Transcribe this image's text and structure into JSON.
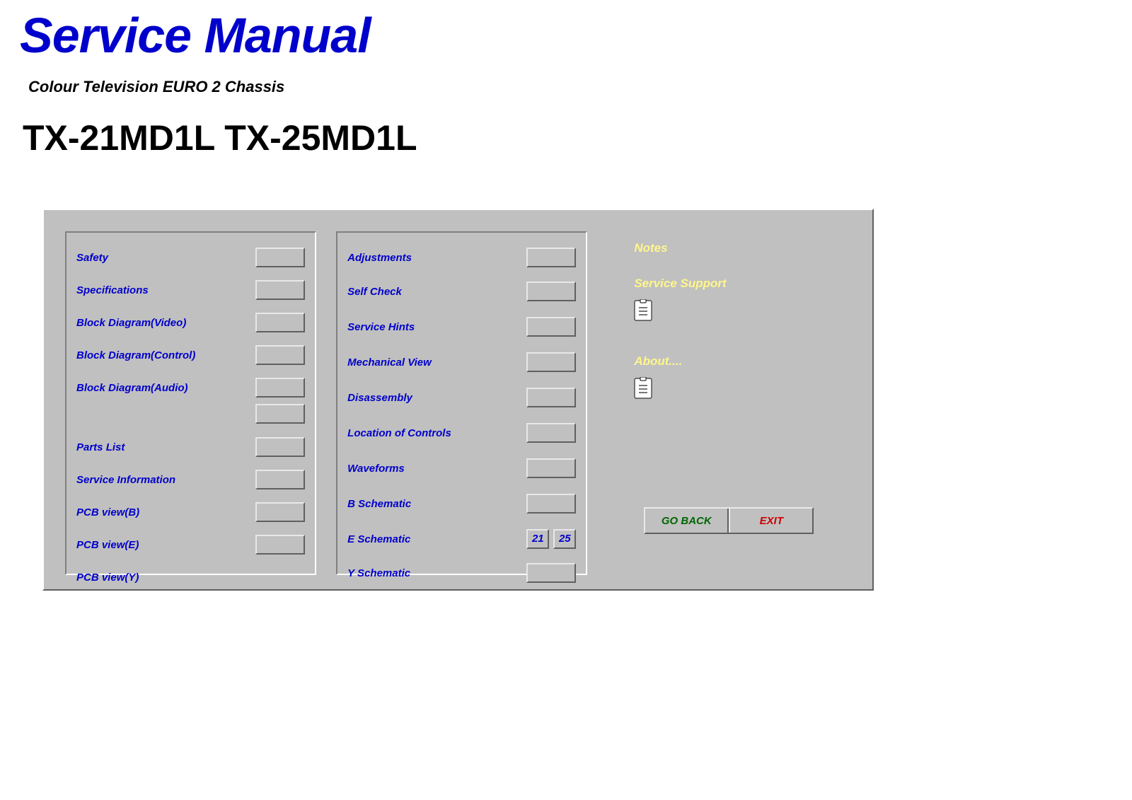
{
  "header": {
    "title": "Service Manual",
    "subtitle": "Colour Television EURO 2 Chassis",
    "model": "TX-21MD1L TX-25MD1L"
  },
  "col1": {
    "items": [
      {
        "label": "Safety"
      },
      {
        "label": "Specifications"
      },
      {
        "label": "Block Diagram(Video)"
      },
      {
        "label": "Block Diagram(Control)"
      },
      {
        "label": "Block Diagram(Audio)"
      },
      {
        "label": "Parts List"
      },
      {
        "label": "Service Information"
      },
      {
        "label": "PCB view(B)"
      },
      {
        "label": "PCB view(E)"
      },
      {
        "label": "PCB view(Y)"
      }
    ]
  },
  "col2": {
    "items": [
      {
        "label": "Adjustments"
      },
      {
        "label": "Self Check"
      },
      {
        "label": "Service Hints"
      },
      {
        "label": "Mechanical View"
      },
      {
        "label": "Disassembly"
      },
      {
        "label": "Location of Controls"
      },
      {
        "label": "Waveforms"
      },
      {
        "label": "B Schematic"
      },
      {
        "label": "E Schematic"
      },
      {
        "label": "Y Schematic"
      }
    ],
    "e_schematic_buttons": [
      "21",
      "25"
    ]
  },
  "col3": {
    "notes_heading": "Notes",
    "support_heading": "Service Support",
    "about_heading": "About....",
    "goback": "GO BACK",
    "exit": "EXIT"
  }
}
